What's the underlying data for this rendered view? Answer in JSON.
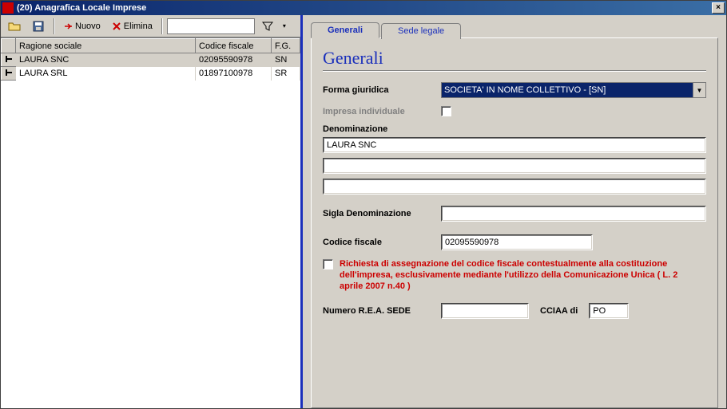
{
  "window": {
    "title": "(20) Anagrafica Locale Imprese",
    "close_glyph": "×"
  },
  "toolbar": {
    "nuovo_label": "Nuovo",
    "elimina_label": "Elimina",
    "search_value": ""
  },
  "grid": {
    "columns": {
      "ragione": "Ragione sociale",
      "codice": "Codice fiscale",
      "fg": "F.G."
    },
    "rows": [
      {
        "ragione": "LAURA SNC",
        "codice": "02095590978",
        "fg": "SN",
        "selected": true
      },
      {
        "ragione": "LAURA SRL",
        "codice": "01897100978",
        "fg": "SR",
        "selected": false
      }
    ]
  },
  "tabs": {
    "generali": "Generali",
    "sede_legale": "Sede legale"
  },
  "form": {
    "heading": "Generali",
    "forma_giuridica_label": "Forma giuridica",
    "forma_giuridica_value": "SOCIETA' IN NOME COLLETTIVO - [SN]",
    "impresa_individuale_label": "Impresa individuale",
    "denominazione_label": "Denominazione",
    "denominazione_value": "LAURA SNC",
    "denominazione_line2": "",
    "denominazione_line3": "",
    "sigla_label": "Sigla Denominazione",
    "sigla_value": "",
    "codice_fiscale_label": "Codice fiscale",
    "codice_fiscale_value": "02095590978",
    "richiesta_note": "Richiesta di assegnazione del codice fiscale contestualmente alla costituzione dell'impresa, esclusivamente mediante l'utilizzo della Comunicazione Unica ( L. 2 aprile 2007 n.40 )",
    "rea_label": "Numero R.E.A. SEDE",
    "rea_value": "",
    "cciaa_label": "CCIAA di",
    "cciaa_value": "PO"
  }
}
